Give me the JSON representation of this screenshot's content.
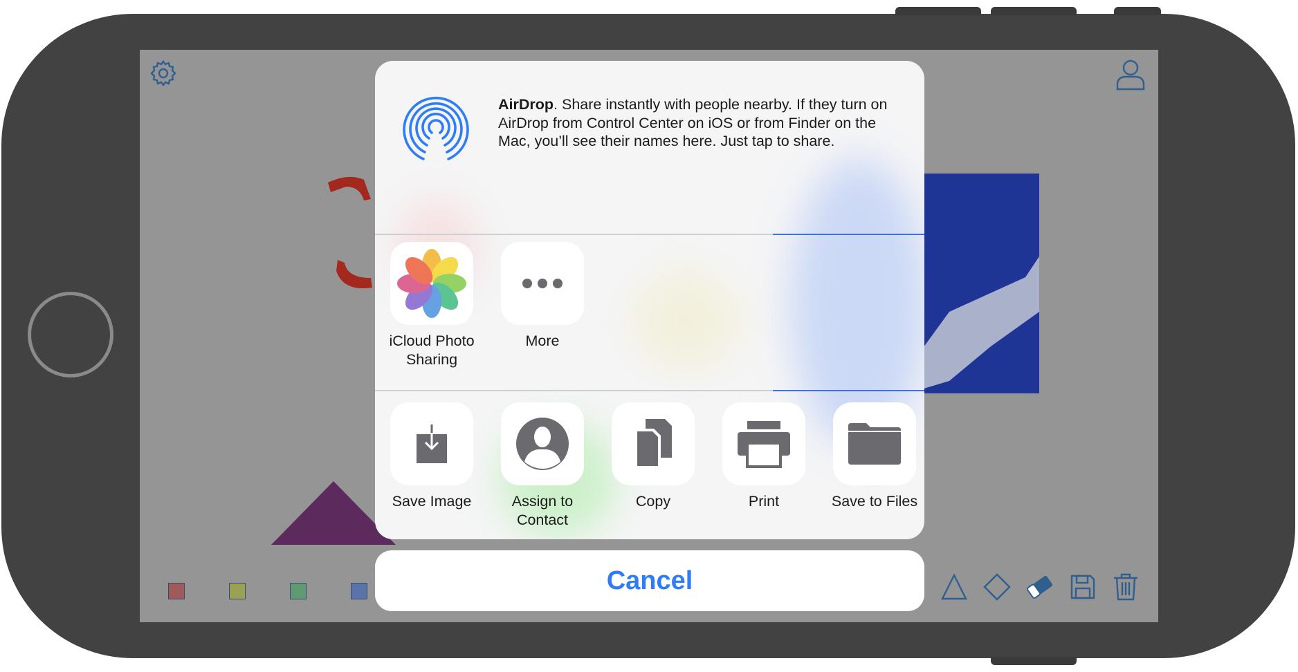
{
  "share_sheet": {
    "airdrop": {
      "title": "AirDrop",
      "description": ". Share instantly with people nearby. If they turn on AirDrop from Control Center on iOS or from Finder on the Mac, you’ll see their names here. Just tap to share.",
      "icon": "airdrop-icon"
    },
    "apps": [
      {
        "label": "iCloud Photo Sharing",
        "icon": "photos-icon"
      },
      {
        "label": "More",
        "icon": "more-icon"
      }
    ],
    "actions": [
      {
        "label": "Save Image",
        "icon": "save-image-icon"
      },
      {
        "label": "Assign to Contact",
        "icon": "contact-icon"
      },
      {
        "label": "Copy",
        "icon": "copy-icon"
      },
      {
        "label": "Print",
        "icon": "printer-icon"
      },
      {
        "label": "Save to Files",
        "icon": "folder-icon"
      }
    ],
    "cancel_label": "Cancel"
  },
  "canvas": {
    "top_icons": [
      "gear-icon",
      "user-icon"
    ],
    "palette_colors": [
      "#a05a5a",
      "#9aa055",
      "#5f9a72",
      "#5a73a8",
      "#8e55a8"
    ],
    "selected_color_index": 4,
    "tools": [
      "triangle-icon",
      "diamond-icon",
      "eraser-icon",
      "save-icon",
      "trash-icon"
    ]
  },
  "colors": {
    "accent": "#2f7df6",
    "shape_blue": "#1f3596",
    "shape_purple": "#5d2a5e",
    "stroke_red": "#a3291f"
  }
}
